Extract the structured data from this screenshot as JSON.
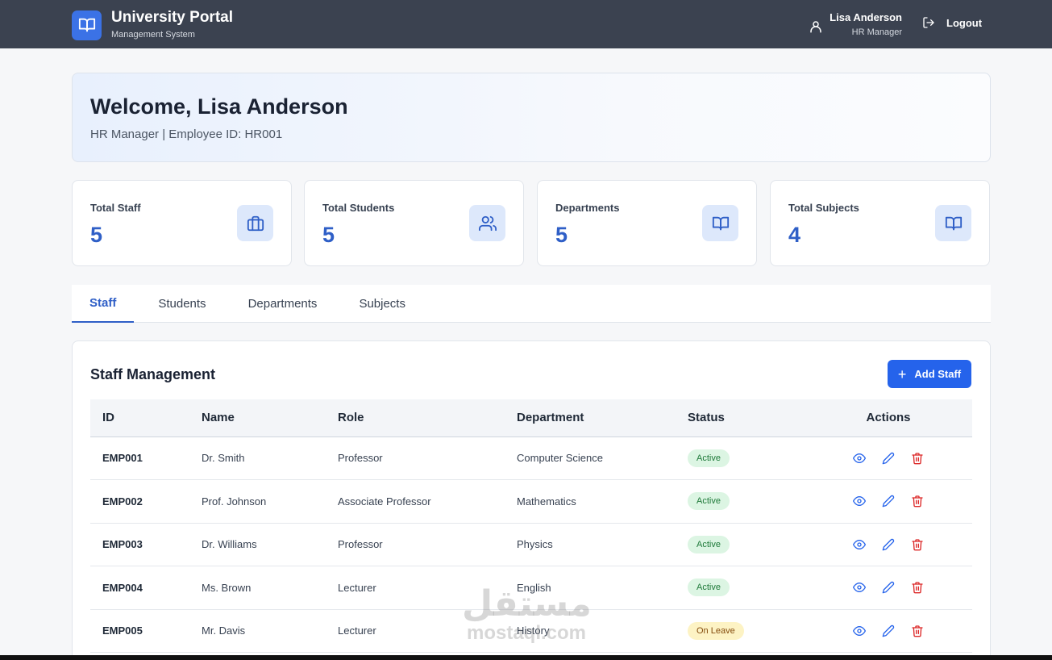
{
  "header": {
    "app_title": "University Portal",
    "app_subtitle": "Management System",
    "user_name": "Lisa Anderson",
    "user_role": "HR Manager",
    "logout_label": "Logout"
  },
  "welcome": {
    "title": "Welcome, Lisa Anderson",
    "subtitle": "HR Manager | Employee ID: HR001"
  },
  "stats": [
    {
      "label": "Total Staff",
      "value": "5",
      "icon": "briefcase-icon"
    },
    {
      "label": "Total Students",
      "value": "5",
      "icon": "users-icon"
    },
    {
      "label": "Departments",
      "value": "5",
      "icon": "book-open-icon"
    },
    {
      "label": "Total Subjects",
      "value": "4",
      "icon": "book-open-icon"
    }
  ],
  "tabs": [
    {
      "label": "Staff",
      "active": true
    },
    {
      "label": "Students",
      "active": false
    },
    {
      "label": "Departments",
      "active": false
    },
    {
      "label": "Subjects",
      "active": false
    }
  ],
  "staff_panel": {
    "title": "Staff Management",
    "add_button_label": "Add Staff",
    "columns": [
      "ID",
      "Name",
      "Role",
      "Department",
      "Status",
      "Actions"
    ],
    "rows": [
      {
        "id": "EMP001",
        "name": "Dr. Smith",
        "role": "Professor",
        "department": "Computer Science",
        "status": "Active"
      },
      {
        "id": "EMP002",
        "name": "Prof. Johnson",
        "role": "Associate Professor",
        "department": "Mathematics",
        "status": "Active"
      },
      {
        "id": "EMP003",
        "name": "Dr. Williams",
        "role": "Professor",
        "department": "Physics",
        "status": "Active"
      },
      {
        "id": "EMP004",
        "name": "Ms. Brown",
        "role": "Lecturer",
        "department": "English",
        "status": "Active"
      },
      {
        "id": "EMP005",
        "name": "Mr. Davis",
        "role": "Lecturer",
        "department": "History",
        "status": "On Leave"
      }
    ]
  },
  "watermark": {
    "arabic": "مستقل",
    "latin": "mostaql.com"
  },
  "colors": {
    "accent": "#2f5fc7",
    "button": "#2563eb",
    "topbar": "#3b4250",
    "danger": "#dc2626",
    "active_badge": "#dcf5e3",
    "leave_badge": "#fdf3c4"
  }
}
